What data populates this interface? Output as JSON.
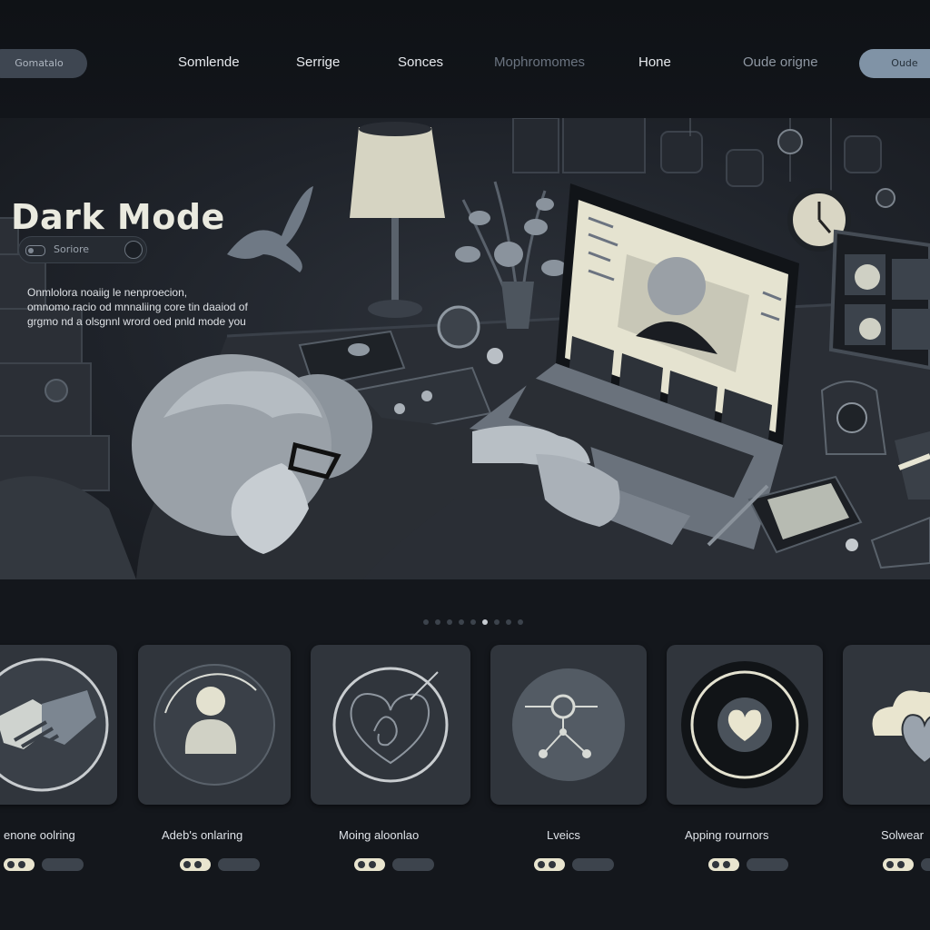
{
  "nav": {
    "left_pill": "Gomatalo",
    "links": [
      "Somlende",
      "Serrige",
      "Sonces",
      "Mophromomes",
      "Hone"
    ],
    "secondary_link": "Oude origne",
    "right_pill": "Oude"
  },
  "hero": {
    "title": "Dark  Mode",
    "search_placeholder": "Soriore",
    "description": [
      "Onmlolora noaiig le nenproecion,",
      "omnomo racio od mnnaliing core tin daaiod of",
      "grgmo nd a olsgnnl wrord oed pnld mode you"
    ]
  },
  "carousel": {
    "count": 9,
    "active_index": 5
  },
  "cards": [
    {
      "label": "enone oolring",
      "icon": "handshake-icon"
    },
    {
      "label": "Adeb's onlaring",
      "icon": "person-icon"
    },
    {
      "label": "Moing aloonlao",
      "icon": "heart-outline-icon"
    },
    {
      "label": "Lveics",
      "icon": "network-icon"
    },
    {
      "label": "Apping rournors",
      "icon": "heart-icon"
    },
    {
      "label": "Solwear",
      "icon": "cloud-heart-icon"
    }
  ],
  "colors": {
    "background": "#14171c",
    "accent_cream": "#e9e5cf",
    "card": "#30353c",
    "pill_right": "#8093a6"
  }
}
